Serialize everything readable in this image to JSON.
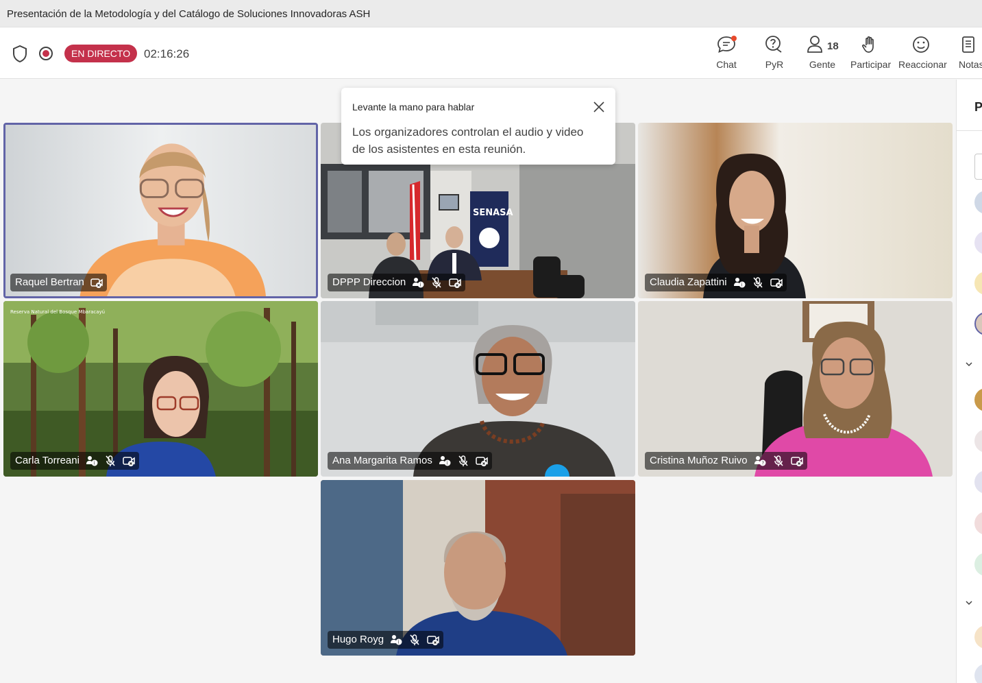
{
  "window": {
    "title": "Presentación de la Metodología y del Catálogo de Soluciones Innovadoras ASH"
  },
  "meeting": {
    "live_badge": "EN DIRECTO",
    "timer": "02:16:26"
  },
  "toolbar": {
    "chat": {
      "label": "Chat",
      "icon": "chat-icon",
      "has_notification": true
    },
    "qa": {
      "label": "PyR",
      "icon": "qa-icon"
    },
    "people": {
      "label": "Gente",
      "icon": "people-icon",
      "count": "18",
      "active": true
    },
    "raise_hand": {
      "label": "Participar",
      "icon": "raise-hand-icon"
    },
    "react": {
      "label": "Reaccionar",
      "icon": "react-emoji-icon"
    },
    "notes": {
      "label": "Notas",
      "icon": "notes-icon"
    }
  },
  "toast": {
    "title": "Levante la mano para hablar",
    "body": "Los organizadores controlan el audio y video de los asistentes en esta reunión."
  },
  "participants": [
    {
      "name": "Raquel Bertran",
      "active_speaker": true,
      "muted": false
    },
    {
      "name": "DPPP Direccion",
      "active_speaker": false,
      "muted": true
    },
    {
      "name": "Claudia Zapattini",
      "active_speaker": false,
      "muted": true
    },
    {
      "name": "Carla Torreani",
      "active_speaker": false,
      "muted": true
    },
    {
      "name": "Ana Margarita Ramos",
      "active_speaker": false,
      "muted": true
    },
    {
      "name": "Cristina Muñoz Ruivo",
      "active_speaker": false,
      "muted": true
    },
    {
      "name": "Hugo Royg",
      "active_speaker": false,
      "muted": true
    }
  ],
  "backgrounds": {
    "senasa_sign": "SENASA",
    "reserve_caption": "Reserva Natural del Bosque Mbaracayú"
  },
  "panel": {
    "title_initial": "P"
  },
  "colors": {
    "accent": "#5b5fc7",
    "live": "#c4314b",
    "active_border": "#6264a7"
  }
}
